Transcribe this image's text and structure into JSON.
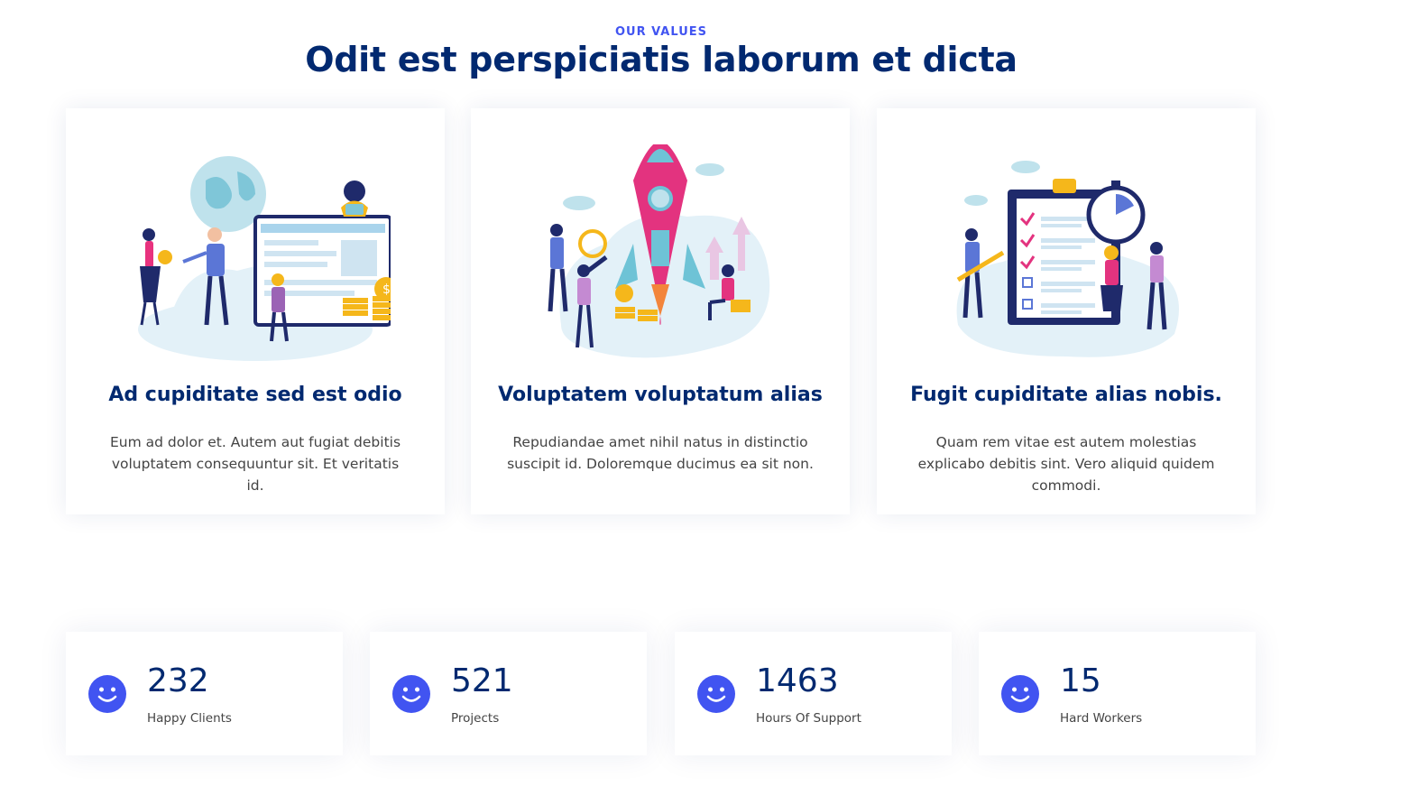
{
  "section": {
    "eyebrow": "OUR VALUES",
    "title": "Odit est perspiciatis laborum et dicta"
  },
  "values": [
    {
      "illustration": "people-globe-dashboard-illustration",
      "title": "Ad cupiditate sed est odio",
      "text": "Eum ad dolor et. Autem aut fugiat debitis voluptatem consequuntur sit. Et veritatis id."
    },
    {
      "illustration": "rocket-launch-illustration",
      "title": "Voluptatem voluptatum alias",
      "text": "Repudiandae amet nihil natus in distinctio suscipit id. Doloremque ducimus ea sit non."
    },
    {
      "illustration": "clipboard-stopwatch-illustration",
      "title": "Fugit cupiditate alias nobis.",
      "text": "Quam rem vitae est autem molestias explicabo debitis sint. Vero aliquid quidem commodi."
    }
  ],
  "stats": [
    {
      "icon": "smiley-icon",
      "value": "232",
      "label": "Happy Clients"
    },
    {
      "icon": "smiley-icon",
      "value": "521",
      "label": "Projects"
    },
    {
      "icon": "smiley-icon",
      "value": "1463",
      "label": "Hours Of Support"
    },
    {
      "icon": "smiley-icon",
      "value": "15",
      "label": "Hard Workers"
    }
  ],
  "colors": {
    "accent": "#4154f1",
    "heading": "#012970",
    "text": "#444444"
  }
}
